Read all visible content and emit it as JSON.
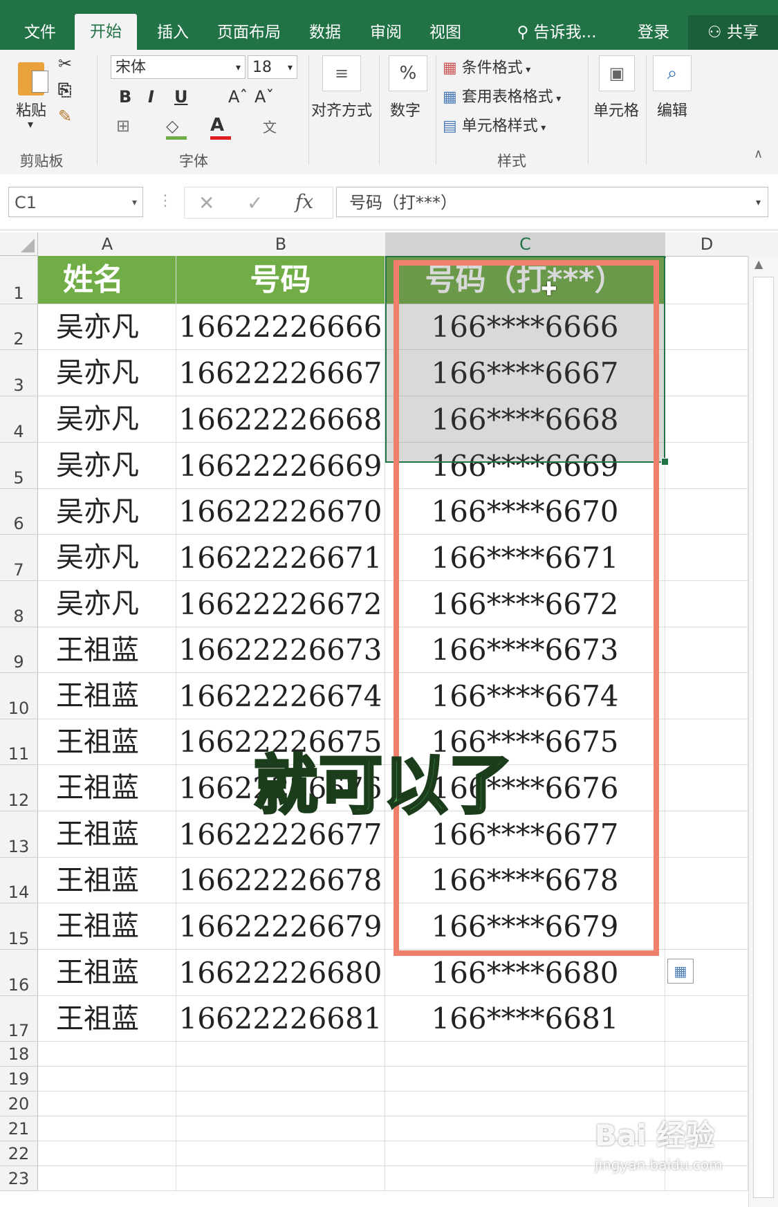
{
  "tabs": [
    "文件",
    "开始",
    "插入",
    "页面布局",
    "数据",
    "审阅",
    "视图"
  ],
  "tell_me": "告诉我...",
  "login": "登录",
  "share": "共享",
  "ribbon": {
    "paste": "粘贴",
    "clipboard": "剪贴板",
    "font_name": "宋体",
    "font_size": "18",
    "font_group": "字体",
    "align": "对齐方式",
    "number": "数字",
    "cond_format": "条件格式",
    "table_format": "套用表格格式",
    "cell_style": "单元格样式",
    "styles_group": "样式",
    "cells": "单元格",
    "edit": "编辑"
  },
  "formula": {
    "name_box": "C1",
    "content": "号码（打***）"
  },
  "columns": [
    "A",
    "B",
    "C",
    "D"
  ],
  "header_row": [
    "姓名",
    "号码",
    "号码（打***）"
  ],
  "rows": [
    [
      "吴亦凡",
      "16622226666",
      "166****6666"
    ],
    [
      "吴亦凡",
      "16622226667",
      "166****6667"
    ],
    [
      "吴亦凡",
      "16622226668",
      "166****6668"
    ],
    [
      "吴亦凡",
      "16622226669",
      "166****6669"
    ],
    [
      "吴亦凡",
      "16622226670",
      "166****6670"
    ],
    [
      "吴亦凡",
      "16622226671",
      "166****6671"
    ],
    [
      "吴亦凡",
      "16622226672",
      "166****6672"
    ],
    [
      "王祖蓝",
      "16622226673",
      "166****6673"
    ],
    [
      "王祖蓝",
      "16622226674",
      "166****6674"
    ],
    [
      "王祖蓝",
      "16622226675",
      "166****6675"
    ],
    [
      "王祖蓝",
      "16622226676",
      "166****6676"
    ],
    [
      "王祖蓝",
      "16622226677",
      "166****6677"
    ],
    [
      "王祖蓝",
      "16622226678",
      "166****6678"
    ],
    [
      "王祖蓝",
      "16622226679",
      "166****6679"
    ],
    [
      "王祖蓝",
      "16622226680",
      "166****6680"
    ],
    [
      "王祖蓝",
      "16622226681",
      "166****6681"
    ]
  ],
  "row_numbers": [
    "1",
    "2",
    "3",
    "4",
    "5",
    "6",
    "7",
    "8",
    "9",
    "10",
    "11",
    "12",
    "13",
    "14",
    "15",
    "16",
    "17",
    "18",
    "19",
    "20",
    "21",
    "22",
    "23"
  ],
  "caption": "就可以了",
  "watermark": {
    "brand": "Bai 经验",
    "url": "jingyan.baidu.com"
  },
  "colors": {
    "excel_green": "#217346",
    "header_fill": "#70ad47",
    "highlight": "#f0806c"
  }
}
